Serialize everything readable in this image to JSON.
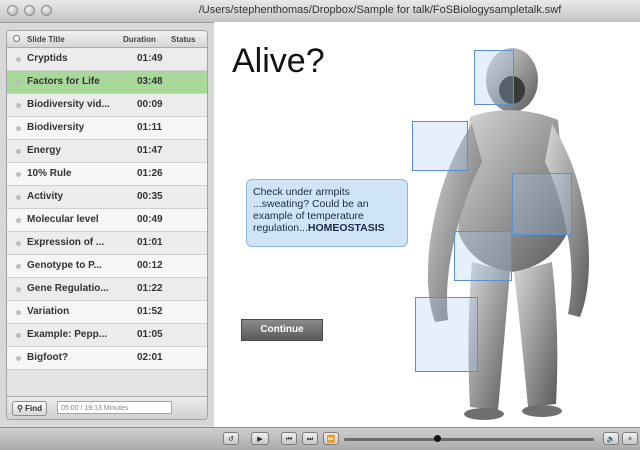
{
  "window": {
    "title": "/Users/stephenthomas/Dropbox/Sample for talk/FoSBiologysampletalk.swf"
  },
  "sidebar": {
    "columns": {
      "title": "Slide Title",
      "duration": "Duration",
      "status": "Status"
    },
    "items": [
      {
        "title": "Cryptids",
        "duration": "01:49"
      },
      {
        "title": "Factors for Life",
        "duration": "03:48",
        "active": true
      },
      {
        "title": "Biodiversity vid...",
        "duration": "00:09"
      },
      {
        "title": "Biodiversity",
        "duration": "01:11"
      },
      {
        "title": "Energy",
        "duration": "01:47"
      },
      {
        "title": "10% Rule",
        "duration": "01:26"
      },
      {
        "title": "Activity",
        "duration": "00:35"
      },
      {
        "title": "Molecular level",
        "duration": "00:49"
      },
      {
        "title": "Expression of ...",
        "duration": "01:01"
      },
      {
        "title": "Genotype to P...",
        "duration": "00:12"
      },
      {
        "title": "Gene Regulatio...",
        "duration": "01:22"
      },
      {
        "title": "Variation",
        "duration": "01:52"
      },
      {
        "title": "Example: Pepp...",
        "duration": "01:05"
      },
      {
        "title": "Bigfoot?",
        "duration": "02:01"
      }
    ],
    "find": {
      "button": "Find",
      "field": "05:00 / 19:13 Minutes"
    }
  },
  "slide": {
    "title": "Alive?",
    "callout_text": "Check under armpits ...sweating? Could be an example of temperature regulation...",
    "callout_emphasis": "HOMEOSTASIS",
    "continue_label": "Continue"
  },
  "controls": {
    "icons": [
      "rewind-icon",
      "play-icon",
      "previous-icon",
      "next-icon",
      "fast-forward-icon",
      "volume-icon",
      "close-icon"
    ],
    "progress": 0.37
  },
  "colors": {
    "active_row": "#a8d89a",
    "callout_bg": "#cfe5f7",
    "hotspot_border": "#5a8fd0"
  }
}
